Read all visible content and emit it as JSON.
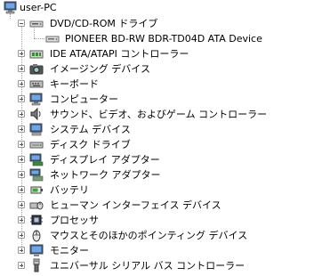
{
  "root": {
    "label": "user-PC",
    "icon": "computer-icon"
  },
  "dvd": {
    "label": "DVD/CD-ROM ドライブ",
    "icon": "dvd-drive-icon",
    "expanded": true
  },
  "dvd_child": {
    "label": "PIONEER BD-RW   BDR-TD04D ATA Device",
    "icon": "optical-drive-icon"
  },
  "items": [
    {
      "label": "IDE ATA/ATAPI コントローラー",
      "icon": "ide-controller-icon"
    },
    {
      "label": "イメージング デバイス",
      "icon": "camera-icon"
    },
    {
      "label": "キーボード",
      "icon": "keyboard-icon"
    },
    {
      "label": "コンピューター",
      "icon": "computer-icon"
    },
    {
      "label": "サウンド、ビデオ、およびゲーム コントローラー",
      "icon": "speaker-icon"
    },
    {
      "label": "システム デバイス",
      "icon": "system-devices-icon"
    },
    {
      "label": "ディスク ドライブ",
      "icon": "disk-drive-icon"
    },
    {
      "label": "ディスプレイ アダプター",
      "icon": "display-adapter-icon"
    },
    {
      "label": "ネットワーク アダプター",
      "icon": "network-adapter-icon"
    },
    {
      "label": "バッテリ",
      "icon": "battery-icon"
    },
    {
      "label": "ヒューマン インターフェイス デバイス",
      "icon": "hid-icon"
    },
    {
      "label": "プロセッサ",
      "icon": "processor-icon"
    },
    {
      "label": "マウスとそのほかのポインティング デバイス",
      "icon": "mouse-icon"
    },
    {
      "label": "モニター",
      "icon": "monitor-icon"
    },
    {
      "label": "ユニバーサル シリアル バス コントローラー",
      "icon": "usb-icon"
    }
  ]
}
